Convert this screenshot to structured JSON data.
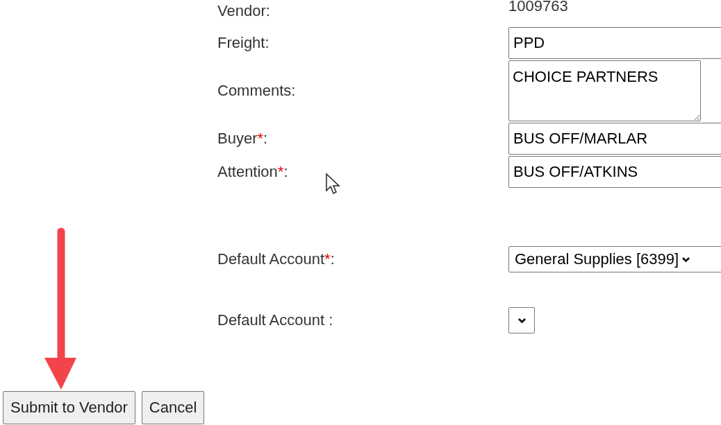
{
  "fields": [
    {
      "kind": "text",
      "label": "Vendor:",
      "value": "1009763"
    },
    {
      "kind": "input",
      "label": "Freight:",
      "value": "PPD"
    },
    {
      "kind": "textarea",
      "label": "Comments:",
      "value": "CHOICE PARTNERS"
    },
    {
      "kind": "input",
      "label": "Buyer",
      "required_mark": "*",
      "label_end": ":",
      "value": "BUS OFF/MARLAR"
    },
    {
      "kind": "input",
      "label": "Attention",
      "required_mark": "*",
      "label_end": ":",
      "value": "BUS OFF/ATKINS"
    },
    {
      "kind": "select",
      "label": "Default Account",
      "required_mark": "*",
      "label_end": ":",
      "value": "General Supplies [6399]"
    },
    {
      "kind": "select",
      "label": "Default Account :"
    }
  ],
  "buttons": [
    "Submit to Vendor",
    "Cancel"
  ]
}
